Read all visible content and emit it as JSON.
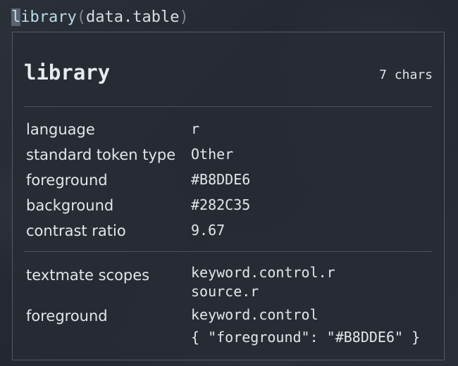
{
  "code_line": {
    "cursor_char": "l",
    "function_rest": "ibrary",
    "open_paren": "(",
    "argument": "data.table",
    "close_paren": ")"
  },
  "hover": {
    "title": "library",
    "char_count": "7 chars",
    "rows": [
      {
        "label": "language",
        "value": "r"
      },
      {
        "label": "standard token type",
        "value": "Other"
      },
      {
        "label": "foreground",
        "value": "#B8DDE6"
      },
      {
        "label": "background",
        "value": "#282C35"
      },
      {
        "label": "contrast ratio",
        "value": "9.67"
      }
    ],
    "scopes": {
      "label": "textmate scopes",
      "values": [
        "keyword.control.r",
        "source.r"
      ]
    },
    "rule": {
      "label": "foreground",
      "selector": "keyword.control",
      "setting": "{ \"foreground\": \"#B8DDE6\" }"
    }
  },
  "colors": {
    "token_foreground": "#B8DDE6",
    "editor_background": "#282C35"
  }
}
